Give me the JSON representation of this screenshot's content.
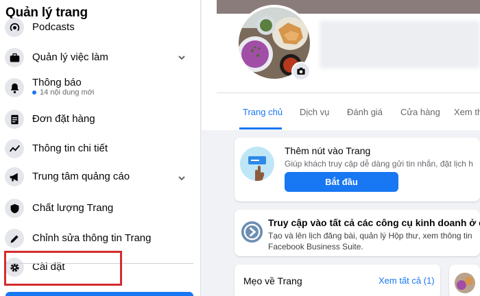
{
  "sidebar": {
    "title": "Quản lý trang",
    "items": [
      {
        "label": "Podcasts",
        "icon": "podcast-icon"
      },
      {
        "label": "Quản lý việc làm",
        "icon": "briefcase-icon"
      },
      {
        "label": "Thông báo",
        "icon": "bell-icon",
        "sub": "14 nội dung mới"
      },
      {
        "label": "Đơn đặt hàng",
        "icon": "orders-icon"
      },
      {
        "label": "Thông tin chi tiết",
        "icon": "insights-icon"
      },
      {
        "label": "Trung tâm quảng cáo",
        "icon": "megaphone-icon"
      },
      {
        "label": "Chất lượng Trang",
        "icon": "shield-icon"
      },
      {
        "label": "Chỉnh sửa thông tin Trang",
        "icon": "pencil-icon"
      },
      {
        "label": "Cài đặt",
        "icon": "gear-icon"
      }
    ]
  },
  "tabs": [
    {
      "label": "Trang chủ",
      "active": true
    },
    {
      "label": "Dịch vụ"
    },
    {
      "label": "Đánh giá"
    },
    {
      "label": "Cửa hàng"
    },
    {
      "label": "Xem th"
    }
  ],
  "add_button_card": {
    "title": "Thêm nút vào Trang",
    "description": "Giúp khách truy cập dễ dàng gửi tin nhắn, đặt lịch h",
    "button": "Bắt đầu"
  },
  "business_card": {
    "title": "Truy cập vào tất cả các công cụ kinh doanh ở c",
    "line1": "Tạo và lên lịch đăng bài, quản lý Hộp thư, xem thông tin",
    "line2": "Facebook Business Suite."
  },
  "tips_card": {
    "title": "Mẹo về Trang",
    "link": "Xem tất cả (1)"
  },
  "colors": {
    "accent": "#1877f2",
    "highlight_box": "#d42c2c"
  }
}
